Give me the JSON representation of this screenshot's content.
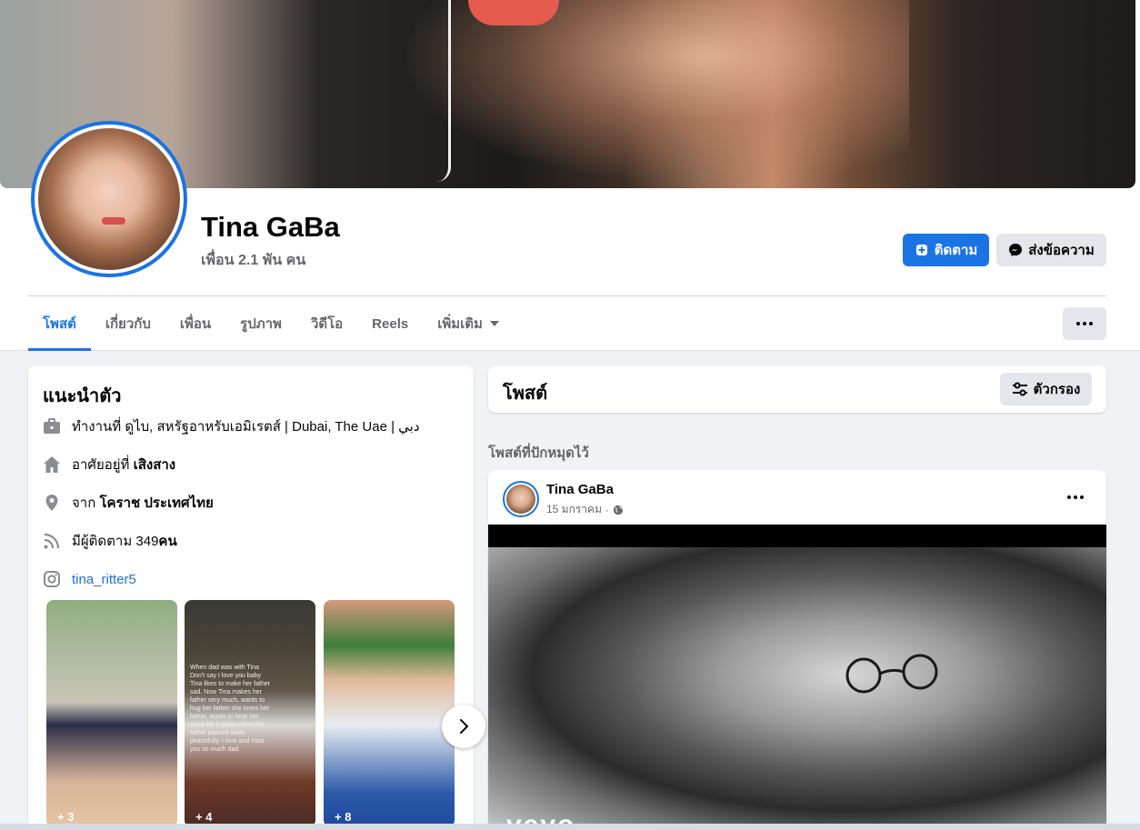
{
  "profile": {
    "name": "Tina GaBa",
    "friends": "เพื่อน 2.1 พัน คน"
  },
  "actions": {
    "follow_label": "ติดตาม",
    "message_label": "ส่งข้อความ"
  },
  "tabs": [
    {
      "label": "โพสต์",
      "active": true
    },
    {
      "label": "เกี่ยวกับ"
    },
    {
      "label": "เพื่อน"
    },
    {
      "label": "รูปภาพ"
    },
    {
      "label": "วิดีโอ"
    },
    {
      "label": "Reels"
    },
    {
      "label": "เพิ่มเติม"
    }
  ],
  "intro": {
    "title": "แนะนำตัว",
    "work_prefix": "ทำงานที่ ",
    "work_value": "ดูไบ, สหรัฐอาหรับเอมิเรตส์ | Dubai, The Uae | دبي",
    "lives_prefix": "อาศัยอยู่ที่ ",
    "lives_value": "เสิงสาง",
    "from_prefix": "จาก ",
    "from_value": "โคราช ประเทศไทย",
    "followers_prefix": "มีผู้ติดตาม 349 ",
    "followers_value": "คน",
    "instagram": "tina_ritter5"
  },
  "photos": [
    {
      "count": "+ 3"
    },
    {
      "count": "+ 4",
      "caption": "When dad was with Tina Don't say I love you baby Tina likes to make her father sad. Now Tina makes her father very much, wants to hug her father she loves her father, wants to hear her voice for 2 years when her father passed away peacefully. I love and miss you so much dad."
    },
    {
      "count": "+ 8"
    }
  ],
  "posts": {
    "title": "โพสต์",
    "filter_label": "ตัวกรอง",
    "pinned_label": "โพสต์ที่ปักหมุดไว้",
    "pinned_post": {
      "author": "Tina GaBa",
      "date": "15 มกราคม",
      "separator": "·",
      "watermark": "vevo"
    }
  },
  "colors": {
    "accent": "#1b74e4",
    "background": "#f0f2f5",
    "secondary_text": "#65676b"
  }
}
